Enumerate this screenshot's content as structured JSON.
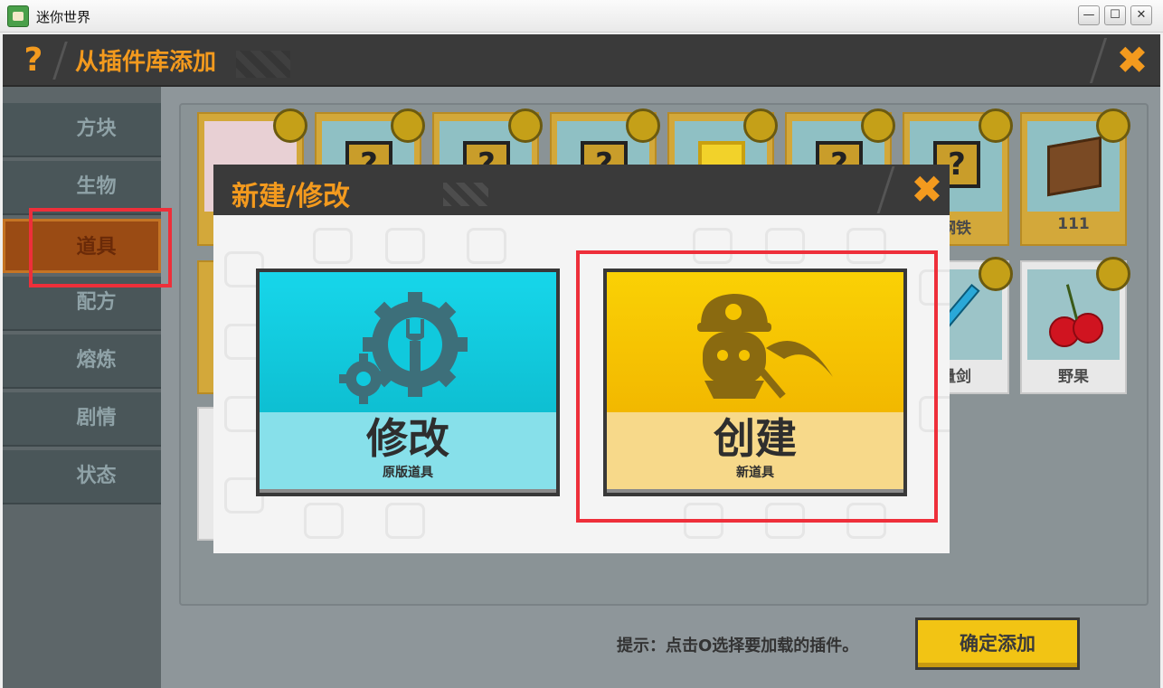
{
  "window": {
    "title": "迷你世界",
    "minimize": "—",
    "maximize": "☐",
    "close": "✕"
  },
  "header": {
    "help": "?",
    "title": "从插件库添加",
    "close": "✖"
  },
  "sidebar": {
    "items": [
      {
        "label": "方块"
      },
      {
        "label": "生物"
      },
      {
        "label": "道具",
        "active": true
      },
      {
        "label": "配方"
      },
      {
        "label": "熔炼"
      },
      {
        "label": "剧情"
      },
      {
        "label": "状态"
      }
    ]
  },
  "grid": {
    "row1": [
      {
        "icon": "crystal-icon",
        "caption": ""
      },
      {
        "icon": "question-block-icon",
        "caption": ""
      },
      {
        "icon": "question-block-icon",
        "caption": ""
      },
      {
        "icon": "question-block-icon",
        "caption": ""
      },
      {
        "icon": "gold-block-icon",
        "caption": ""
      },
      {
        "icon": "question-block-icon",
        "caption": ""
      },
      {
        "icon": "question-block-icon",
        "caption": "钢铁"
      },
      {
        "icon": "crate-icon",
        "caption": "111"
      }
    ],
    "row2": [
      {
        "icon": "blue-sword-icon",
        "caption": "量剑"
      },
      {
        "icon": "cherry-icon",
        "caption": "野果"
      }
    ]
  },
  "footer": {
    "hint": "提示：点击O选择要加载的插件。",
    "confirm": "确定添加"
  },
  "modal": {
    "title": "新建/修改",
    "close": "✖",
    "modify": {
      "label": "修改",
      "sub": "原版道具",
      "icon": "gears-icon"
    },
    "create": {
      "label": "创建",
      "sub": "新道具",
      "icon": "miner-icon"
    }
  },
  "colors": {
    "accent_orange": "#f39a1e",
    "highlight_red": "#ee2f3a",
    "modify_cyan": "#17d6ea",
    "create_yellow": "#fad105"
  }
}
